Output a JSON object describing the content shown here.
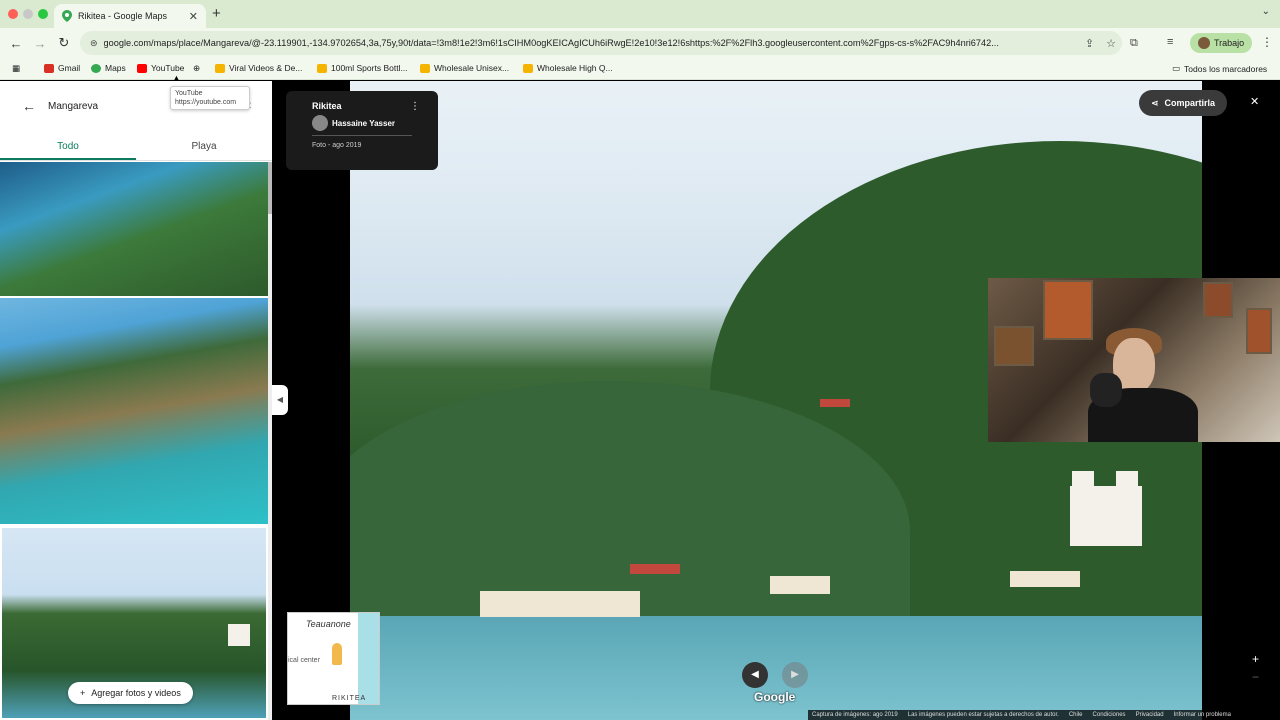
{
  "browser": {
    "tab_title": "Rikitea - Google Maps",
    "url": "google.com/maps/place/Mangareva/@-23.119901,-134.9702654,3a,75y,90t/data=!3m8!1e2!3m6!1sCIHM0ogKEICAgICUh6iRwgE!2e10!3e12!6shttps:%2F%2Flh3.googleusercontent.com%2Fgps-cs-s%2FAC9h4nri6742...",
    "profile_label": "Trabajo",
    "bookmarks": [
      {
        "label": "Gmail",
        "color": "#d93025"
      },
      {
        "label": "Maps",
        "color": "#34a853"
      },
      {
        "label": "YouTube",
        "color": "#ff0000"
      },
      {
        "label": "Viral Videos & De...",
        "color": "#f4b400"
      },
      {
        "label": "100ml Sports Bottl...",
        "color": "#f4b400"
      },
      {
        "label": "Wholesale Unisex...",
        "color": "#f4b400"
      },
      {
        "label": "Wholesale High Q...",
        "color": "#f4b400"
      }
    ],
    "all_bookmarks": "Todos los marcadores",
    "tooltip_title": "YouTube",
    "tooltip_url": "https://youtube.com"
  },
  "sidebar": {
    "search_query": "Mangareva",
    "tabs": [
      {
        "label": "Todo",
        "active": true
      },
      {
        "label": "Playa",
        "active": false
      }
    ],
    "add_button": "Agregar fotos y videos"
  },
  "photo_info": {
    "place": "Rikitea",
    "author": "Hassaine Yasser",
    "date": "Foto - ago 2019"
  },
  "share_label": "Compartirla",
  "minimap": {
    "label_top": "Teauanone",
    "label_mid": "ical center",
    "label_bottom": "RIKITEA"
  },
  "google_logo": "Google",
  "footer": {
    "capture": "Captura de imágenes: ago 2019",
    "rights": "Las imágenes pueden estar sujetas a derechos de autor.",
    "terms1": "Chile",
    "terms2": "Condiciones",
    "privacy": "Privacidad",
    "report": "Informar un problema"
  }
}
